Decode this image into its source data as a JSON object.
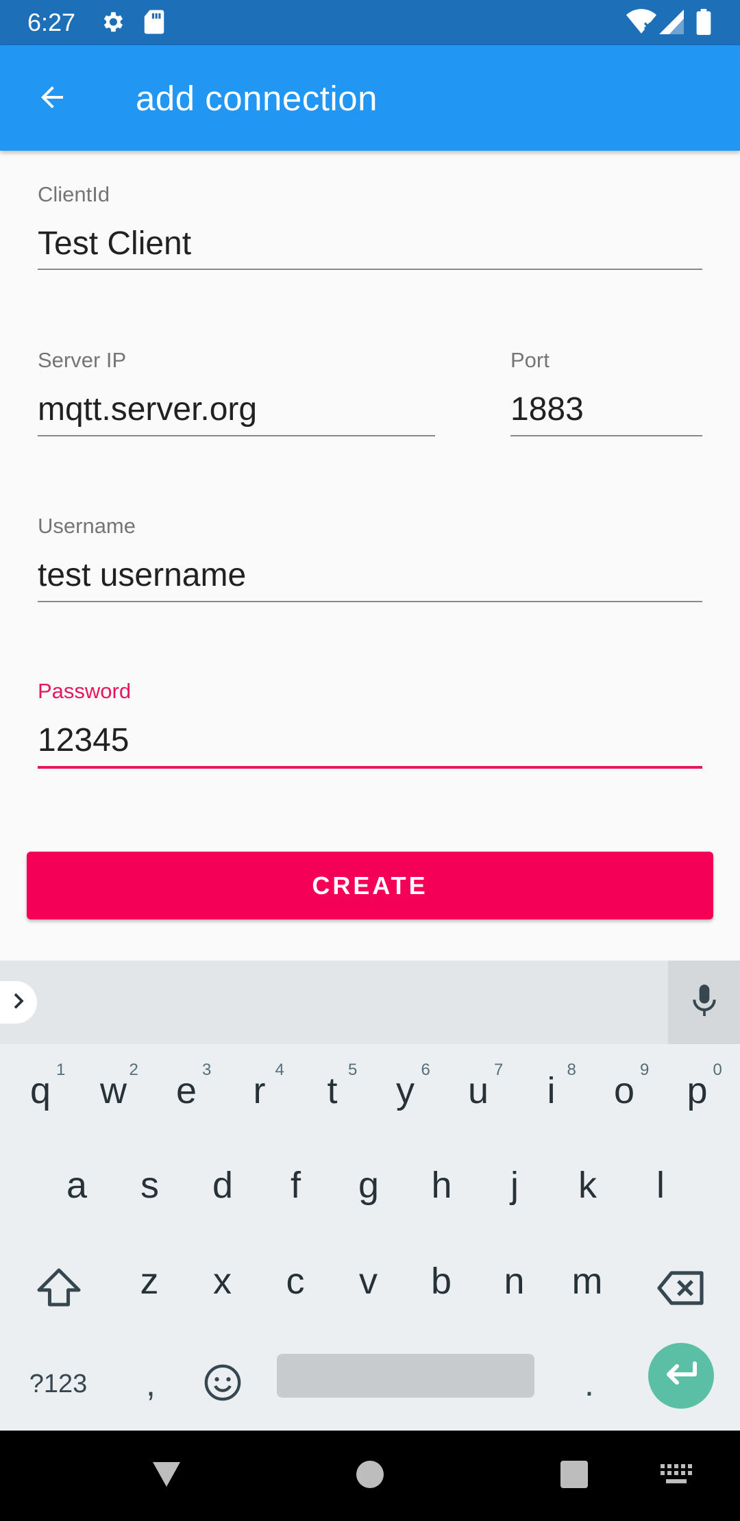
{
  "status_bar": {
    "time": "6:27",
    "icons": [
      "settings-icon",
      "sd-card-icon",
      "wifi-icon",
      "signal-icon",
      "battery-icon"
    ],
    "background": "#1d6fb8"
  },
  "app_bar": {
    "title": "add connection",
    "background": "#2196f3"
  },
  "form": {
    "client_id": {
      "label": "ClientId",
      "value": "Test Client"
    },
    "server_ip": {
      "label": "Server IP",
      "value": "mqtt.server.org"
    },
    "port": {
      "label": "Port",
      "value": "1883"
    },
    "username": {
      "label": "Username",
      "value": "test username"
    },
    "password": {
      "label": "Password",
      "value": "12345",
      "focused": true
    },
    "accent_color": "#e8175d"
  },
  "create_button": {
    "label": "CREATE",
    "color": "#f50057"
  },
  "keyboard": {
    "row1": [
      {
        "key": "q",
        "hint": "1"
      },
      {
        "key": "w",
        "hint": "2"
      },
      {
        "key": "e",
        "hint": "3"
      },
      {
        "key": "r",
        "hint": "4"
      },
      {
        "key": "t",
        "hint": "5"
      },
      {
        "key": "y",
        "hint": "6"
      },
      {
        "key": "u",
        "hint": "7"
      },
      {
        "key": "i",
        "hint": "8"
      },
      {
        "key": "o",
        "hint": "9"
      },
      {
        "key": "p",
        "hint": "0"
      }
    ],
    "row2": [
      "a",
      "s",
      "d",
      "f",
      "g",
      "h",
      "j",
      "k",
      "l"
    ],
    "row3": [
      "z",
      "x",
      "c",
      "v",
      "b",
      "n",
      "m"
    ],
    "symbols_label": "?123",
    "comma": ",",
    "period": ".",
    "enter_color": "#5bbfa6"
  },
  "nav_bar": {
    "buttons": [
      "back-triangle-icon",
      "home-circle-icon",
      "recents-square-icon",
      "keyboard-switch-icon"
    ]
  }
}
